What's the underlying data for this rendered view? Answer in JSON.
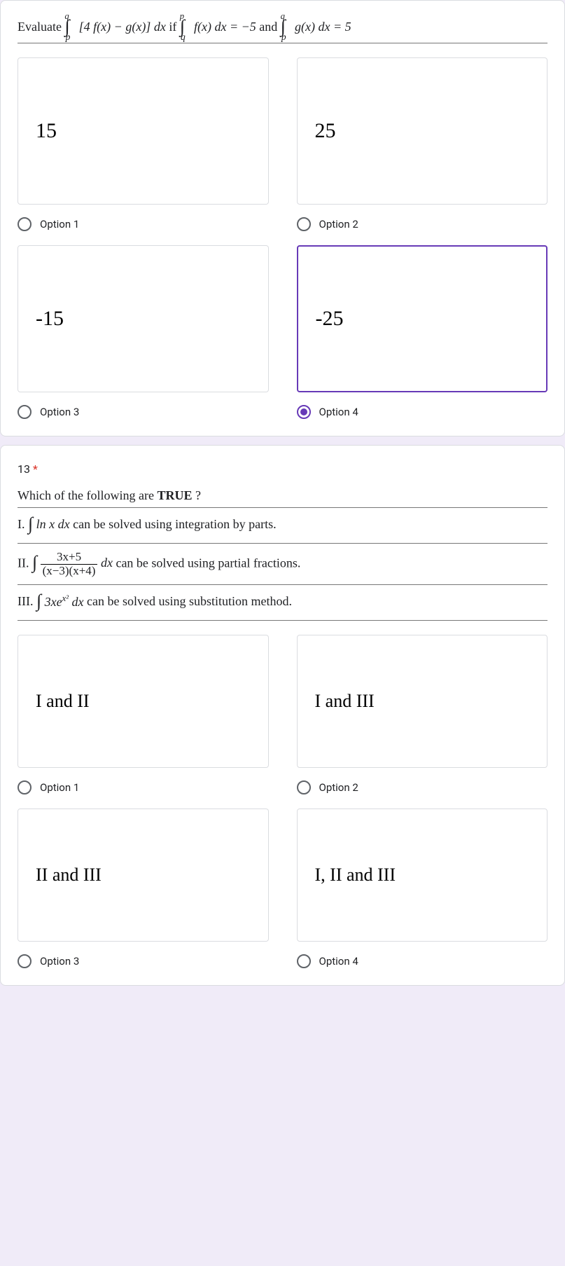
{
  "question12": {
    "prompt_prefix": "Evaluate ",
    "prompt_integral": "∫ₚ𐞥 [4 f(x) − g(x)] dx",
    "prompt_mid": " if ",
    "prompt_cond1": "∫𐞥ᵖ f(x) dx = −5",
    "prompt_and": " and ",
    "prompt_cond2": "∫ₚ𐞥 g(x) dx = 5",
    "options": [
      {
        "value": "15",
        "label": "Option 1",
        "selected": false
      },
      {
        "value": "25",
        "label": "Option 2",
        "selected": false
      },
      {
        "value": "-15",
        "label": "Option 3",
        "selected": false
      },
      {
        "value": "-25",
        "label": "Option 4",
        "selected": true
      }
    ]
  },
  "question13": {
    "number": "13",
    "required_marker": "*",
    "prompt": "Which of the following are TRUE ?",
    "statements": {
      "s1_prefix": "I. ",
      "s1_int": "∫ ln x dx",
      "s1_suffix": " can be solved using integration by parts.",
      "s2_prefix": "II. ",
      "s2_int_left": "∫ ",
      "s2_frac_num": "3x+5",
      "s2_frac_den": "(x−3)(x+4)",
      "s2_int_right": " dx",
      "s2_suffix": " can be solved using partial fractions.",
      "s3_prefix": "III. ",
      "s3_int": "∫ 3xeˣ² dx",
      "s3_suffix": " can be solved using substitution method."
    },
    "options": [
      {
        "value": "I and II",
        "label": "Option 1",
        "selected": false
      },
      {
        "value": "I and III",
        "label": "Option 2",
        "selected": false
      },
      {
        "value": "II and III",
        "label": "Option 3",
        "selected": false
      },
      {
        "value": "I, II and III",
        "label": "Option 4",
        "selected": false
      }
    ]
  }
}
